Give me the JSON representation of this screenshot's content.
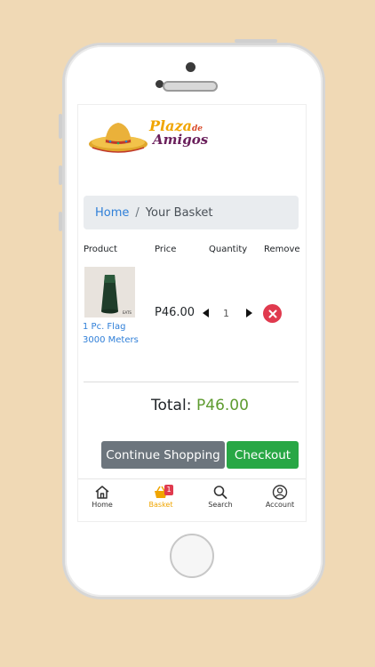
{
  "logo": {
    "line1": "Plaza",
    "line1_small": "de",
    "line2": "Amigos"
  },
  "breadcrumb": {
    "home": "Home",
    "separator": "/",
    "current": "Your Basket"
  },
  "table": {
    "headers": [
      "Product",
      "Price",
      "Quantity",
      "Remove"
    ],
    "rows": [
      {
        "name": "1 Pc. Flag 3000 Meters",
        "price": "P46.00",
        "quantity": "1",
        "image_label": "EATS"
      }
    ]
  },
  "total": {
    "label": "Total:",
    "value": "P46.00"
  },
  "buttons": {
    "continue": "Continue Shopping",
    "checkout": "Checkout"
  },
  "nav": {
    "items": [
      {
        "label": "Home",
        "icon": "home-icon"
      },
      {
        "label": "Basket",
        "icon": "basket-icon",
        "badge": "1",
        "active": true
      },
      {
        "label": "Search",
        "icon": "search-icon"
      },
      {
        "label": "Account",
        "icon": "account-icon"
      }
    ]
  },
  "colors": {
    "background": "#f0d9b5",
    "accent": "#f0a500",
    "link": "#2f7fd8",
    "total": "#5e9b2f",
    "checkout": "#28a745",
    "continue": "#6c757d",
    "remove": "#e03a4e"
  }
}
